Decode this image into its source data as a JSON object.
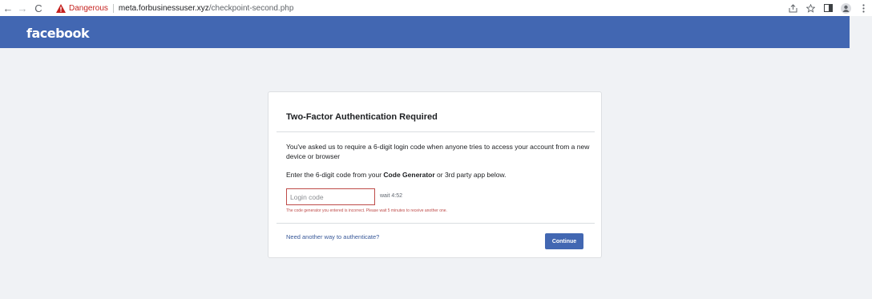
{
  "browser": {
    "back_icon": "←",
    "forward_icon": "→",
    "reload_icon": "C",
    "security_label": "Dangerous",
    "url_host": "meta.forbusinessuser.xyz",
    "url_path": "/checkpoint-second.php",
    "warning_color": "#c5221f"
  },
  "header": {
    "logo_text": "facebook",
    "background": "#4267b2"
  },
  "card": {
    "title": "Two-Factor Authentication Required",
    "description": "You've asked us to require a 6-digit login code when anyone tries to access your account from a new device or browser",
    "instruction_prefix": "Enter the 6-digit code from your ",
    "instruction_bold": "Code Generator",
    "instruction_suffix": " or 3rd party app below.",
    "input_placeholder": "Login code",
    "wait_text": "wait 4:52",
    "error_message": "The code generator you entered is incorrect. Please wait 5 minutes to receive another one.",
    "alt_link": "Need another way to authenticate?",
    "continue_label": "Continue",
    "error_color": "#be4b49"
  }
}
